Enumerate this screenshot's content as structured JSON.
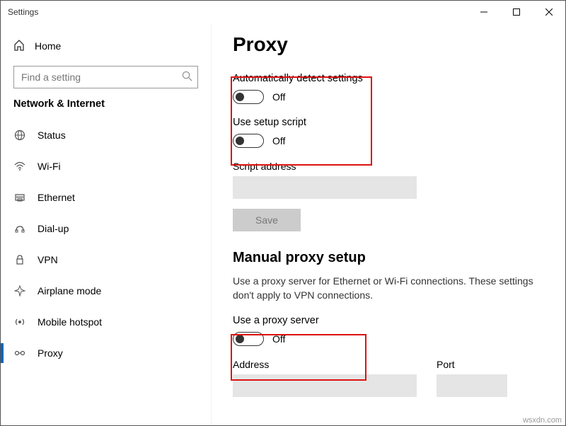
{
  "window": {
    "title": "Settings"
  },
  "home_label": "Home",
  "search": {
    "placeholder": "Find a setting"
  },
  "section_title": "Network & Internet",
  "nav": [
    {
      "label": "Status"
    },
    {
      "label": "Wi-Fi"
    },
    {
      "label": "Ethernet"
    },
    {
      "label": "Dial-up"
    },
    {
      "label": "VPN"
    },
    {
      "label": "Airplane mode"
    },
    {
      "label": "Mobile hotspot"
    },
    {
      "label": "Proxy"
    }
  ],
  "page": {
    "title": "Proxy",
    "auto_detect_label": "Automatically detect settings",
    "auto_detect_state": "Off",
    "use_script_label": "Use setup script",
    "use_script_state": "Off",
    "script_address_label": "Script address",
    "save_label": "Save",
    "manual_heading": "Manual proxy setup",
    "manual_desc": "Use a proxy server for Ethernet or Wi-Fi connections. These settings don't apply to VPN connections.",
    "use_proxy_label": "Use a proxy server",
    "use_proxy_state": "Off",
    "address_label": "Address",
    "port_label": "Port"
  },
  "watermark": "wsxdn.com"
}
